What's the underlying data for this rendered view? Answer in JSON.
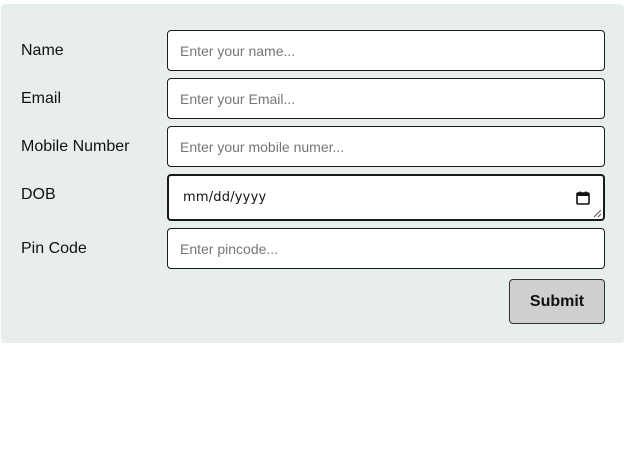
{
  "form": {
    "fields": [
      {
        "label": "Name",
        "placeholder": "Enter your name...",
        "value": ""
      },
      {
        "label": "Email",
        "placeholder": "Enter your Email...",
        "value": ""
      },
      {
        "label": "Mobile Number",
        "placeholder": "Enter your mobile numer...",
        "value": ""
      },
      {
        "label": "DOB",
        "display": "mm/dd/yyyy"
      },
      {
        "label": "Pin Code",
        "placeholder": "Enter pincode...",
        "value": ""
      }
    ],
    "submit_label": "Submit"
  },
  "colors": {
    "card_background": "#e8efeb",
    "button_background": "#cfcfcf",
    "border": "#1a1a1a"
  },
  "icons": {
    "date_picker": "calendar-icon"
  }
}
